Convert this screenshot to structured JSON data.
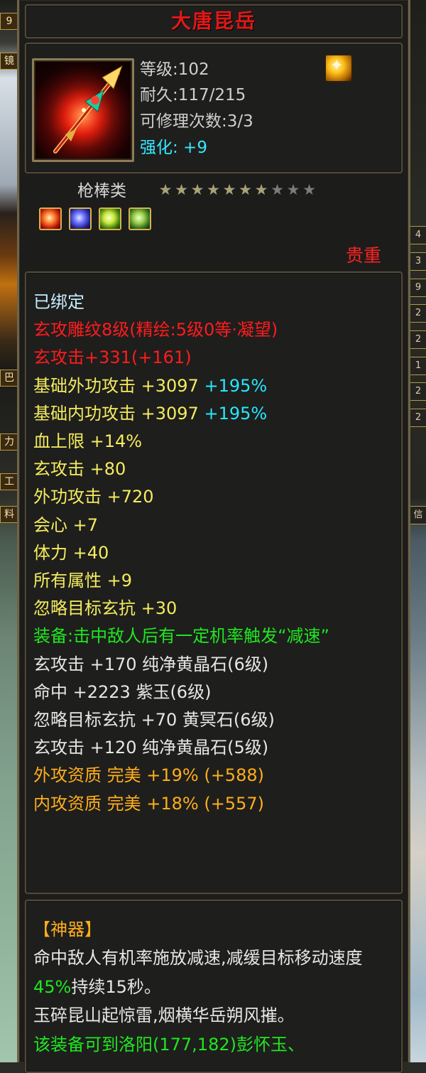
{
  "item": {
    "name": "大唐昆岳",
    "level_label": "等级",
    "level_value": ":102",
    "durability_label": "耐久",
    "durability_value": ":117/215",
    "repair_label": "可修理次数",
    "repair_value": ":3/3",
    "enhance_label": "强化:",
    "enhance_value": " +9",
    "category": "枪棒类",
    "stars": {
      "on": 7,
      "total": 10
    },
    "gem_icons": [
      "red-gem-icon",
      "blue-gem-icon",
      "green-gem-icon",
      "jade-gem-icon"
    ],
    "quality": "贵重"
  },
  "attributes": [
    {
      "text": "已绑定",
      "color": "#c7ecff"
    },
    {
      "text": "玄攻雕纹8级(精绘:5级0等·凝望)",
      "color": "#ff1c1c"
    },
    {
      "text": "玄攻击+331(+161)",
      "color": "#ff1c1c"
    },
    {
      "text": "基础外功攻击 +3097",
      "extra": " +195%",
      "color": "#f4ec5e",
      "extra_color": "#26e8ff"
    },
    {
      "text": "基础内功攻击 +3097",
      "extra": " +195%",
      "color": "#f4ec5e",
      "extra_color": "#26e8ff"
    },
    {
      "text": "血上限 +14%",
      "color": "#f4ec5e"
    },
    {
      "text": "玄攻击 +80",
      "color": "#f4ec5e"
    },
    {
      "text": "外功攻击 +720",
      "color": "#f4ec5e"
    },
    {
      "text": "会心 +7",
      "color": "#f4ec5e"
    },
    {
      "text": "体力 +40",
      "color": "#f4ec5e"
    },
    {
      "text": "所有属性 +9",
      "color": "#f4ec5e"
    },
    {
      "text": "忽略目标玄抗 +30",
      "color": "#f4ec5e"
    },
    {
      "text": "装备:击中敌人后有一定机率触发“减速”",
      "color": "#1ee81e",
      "wrap": true
    },
    {
      "text": "玄攻击 +170 纯净黄晶石(6级)",
      "color": "#e6e6e6"
    },
    {
      "text": "命中 +2223 紫玉(6级)",
      "color": "#e6e6e6"
    },
    {
      "text": "忽略目标玄抗 +70 黄冥石(6级)",
      "color": "#e6e6e6"
    },
    {
      "text": "玄攻击 +120 纯净黄晶石(5级)",
      "color": "#e6e6e6"
    },
    {
      "text": "外攻资质  完美 +19% (+588)",
      "color": "#ffae1a"
    },
    {
      "text": "内攻资质  完美 +18% (+557)",
      "color": "#ffae1a"
    }
  ],
  "artifact": {
    "header": "【神器】",
    "desc_1": "命中敌人有机率施放减速,减缓目标移动速度",
    "desc_pct": "45%",
    "desc_2": "持续15秒。",
    "poem": "玉碎昆山起惊雷,烟横华岳朔风摧。",
    "source": "该装备可到洛阳(177,182)彭怀玉、"
  },
  "side": {
    "left_labels": [
      "9",
      "镜",
      "巴",
      "力",
      "工",
      "料"
    ],
    "right_labels": [
      "4",
      "3",
      "9",
      "2",
      "2",
      "1",
      "2",
      "2",
      "信"
    ]
  }
}
